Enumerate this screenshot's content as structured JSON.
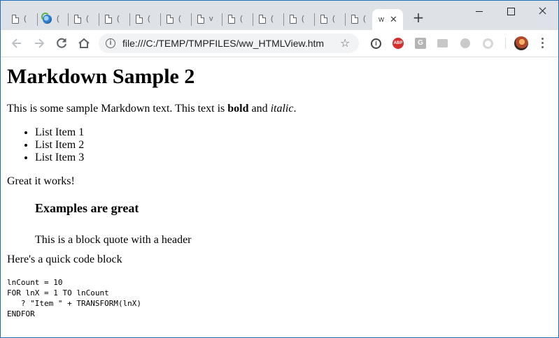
{
  "tabs": [
    {
      "title": "(",
      "icon": "page-icon"
    },
    {
      "title": "(",
      "icon": "edge-globe-icon"
    },
    {
      "title": "(",
      "icon": "page-icon"
    },
    {
      "title": "(",
      "icon": "page-icon"
    },
    {
      "title": "(",
      "icon": "page-icon"
    },
    {
      "title": "(",
      "icon": "page-icon"
    },
    {
      "title": "v",
      "icon": "page-icon"
    },
    {
      "title": "(",
      "icon": "page-icon"
    },
    {
      "title": "(",
      "icon": "page-icon"
    },
    {
      "title": "(",
      "icon": "page-icon"
    },
    {
      "title": "(",
      "icon": "page-icon"
    },
    {
      "title": "(",
      "icon": "page-icon"
    }
  ],
  "active_tab": {
    "title": "w",
    "close": "✕"
  },
  "new_tab": "+",
  "toolbar": {
    "url": "file:///C:/TEMP/TMPFILES/ww_HTMLView.htm",
    "info_glyph": "i",
    "star_glyph": "☆",
    "extensions": {
      "i_ext": "i",
      "abp": "ABP",
      "g_ext": "G"
    }
  },
  "page": {
    "title": "Markdown Sample 2",
    "intro_prefix": "This is some sample Markdown text. This text is ",
    "intro_bold": "bold",
    "intro_mid": " and ",
    "intro_italic": "italic",
    "intro_suffix": ".",
    "list": [
      "List Item 1",
      "List Item 2",
      "List Item 3"
    ],
    "after_list": "Great it works!",
    "quote_header": "Examples are great",
    "quote_text": "This is a block quote with a header",
    "code_intro": "Here's a quick code block",
    "code": "lnCount = 10\nFOR lnX = 1 TO lnCount\n   ? \"Item \" + TRANSFORM(lnX)\nENDFOR"
  }
}
